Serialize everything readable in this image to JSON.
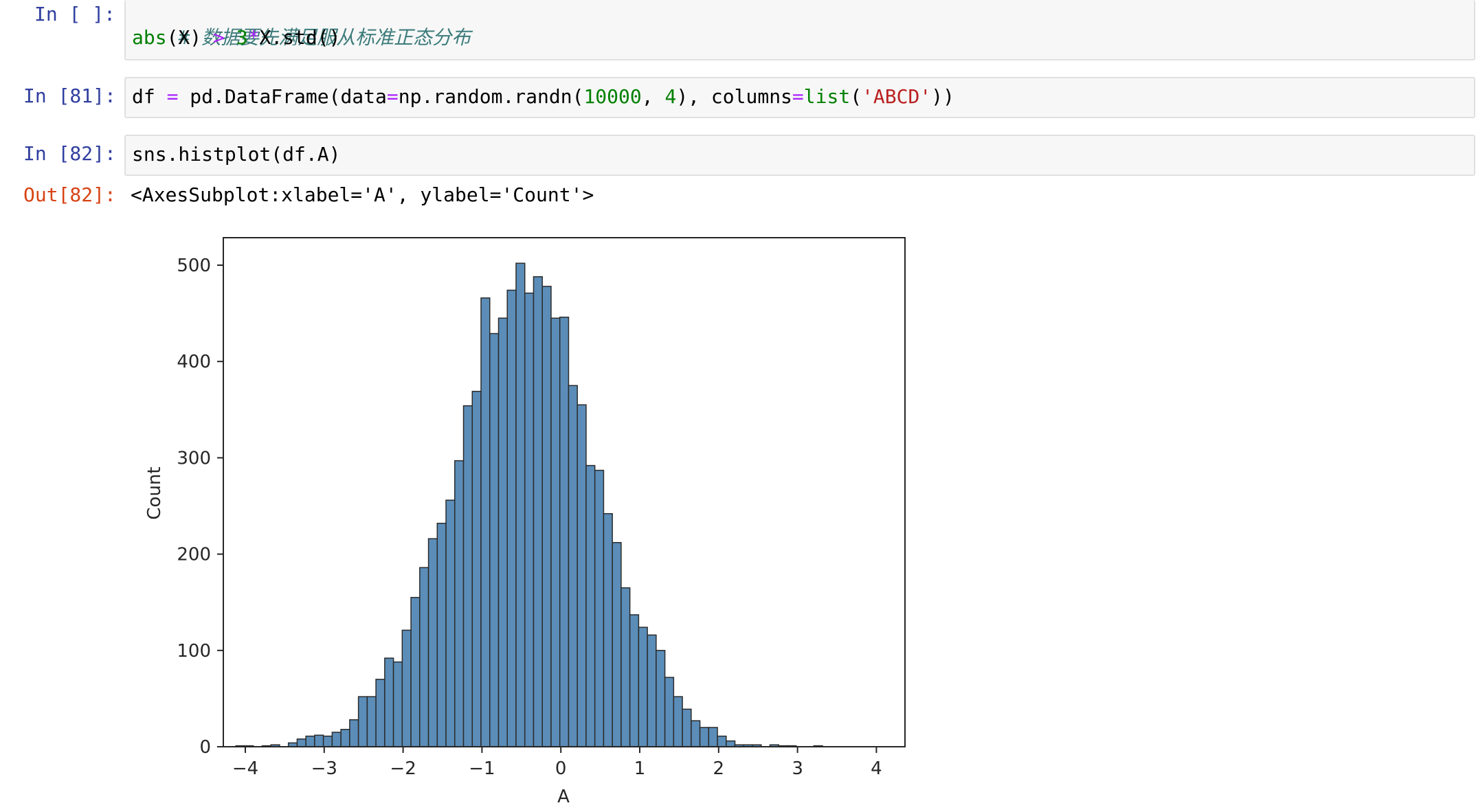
{
  "cells": [
    {
      "prompt": "In [ ]:",
      "line1": {
        "comment": "# 数据要先满足服从标准正态分布"
      },
      "line2": {
        "fn": "abs",
        "a": "(X) ",
        "op1": ">",
        "b": " ",
        "num": "3",
        "op2": "*",
        "c": "X.std()"
      }
    },
    {
      "prompt": "In [81]:",
      "line1": {
        "t1": "df ",
        "op1": "=",
        "t2": " pd.DataFrame(data",
        "op2": "=",
        "t3": "np.random.randn(",
        "n1": "10000",
        "t4": ", ",
        "n2": "4",
        "t5": "), columns",
        "op3": "=",
        "fn": "list",
        "t6": "(",
        "s": "'ABCD'",
        "t7": "))"
      }
    },
    {
      "prompt": "In [82]:",
      "line1": {
        "code": "sns.histplot(df.A)"
      },
      "out_prompt": "Out[82]:",
      "output": "<AxesSubplot:xlabel='A', ylabel='Count'>"
    }
  ],
  "chart_data": {
    "type": "bar",
    "subtype": "histogram",
    "xlabel": "A",
    "ylabel": "Count",
    "xlim": [
      -4.4,
      4.4
    ],
    "ylim": [
      0,
      530
    ],
    "xticks": [
      -4,
      -3,
      -2,
      -1,
      0,
      1,
      2,
      3,
      4
    ],
    "xtick_labels": [
      "−4",
      "−3",
      "−2",
      "−1",
      "0",
      "1",
      "2",
      "3",
      "4"
    ],
    "yticks": [
      0,
      100,
      200,
      300,
      400,
      500
    ],
    "bin_start": -4.12,
    "bin_width": 0.111,
    "values": [
      1,
      1,
      0,
      1,
      2,
      0,
      4,
      8,
      11,
      12,
      11,
      15,
      18,
      28,
      52,
      52,
      70,
      92,
      88,
      121,
      155,
      186,
      216,
      232,
      256,
      297,
      354,
      369,
      466,
      429,
      445,
      474,
      502,
      471,
      488,
      478,
      445,
      446,
      375,
      355,
      292,
      287,
      242,
      212,
      165,
      137,
      124,
      116,
      100,
      72,
      52,
      39,
      27,
      20,
      20,
      11,
      6,
      2,
      2,
      2,
      0,
      2,
      1,
      1,
      0,
      0,
      1
    ],
    "grid": false,
    "legend": "none",
    "bar_color": "#5b8db8",
    "edge_color": "#2b2b2b"
  }
}
